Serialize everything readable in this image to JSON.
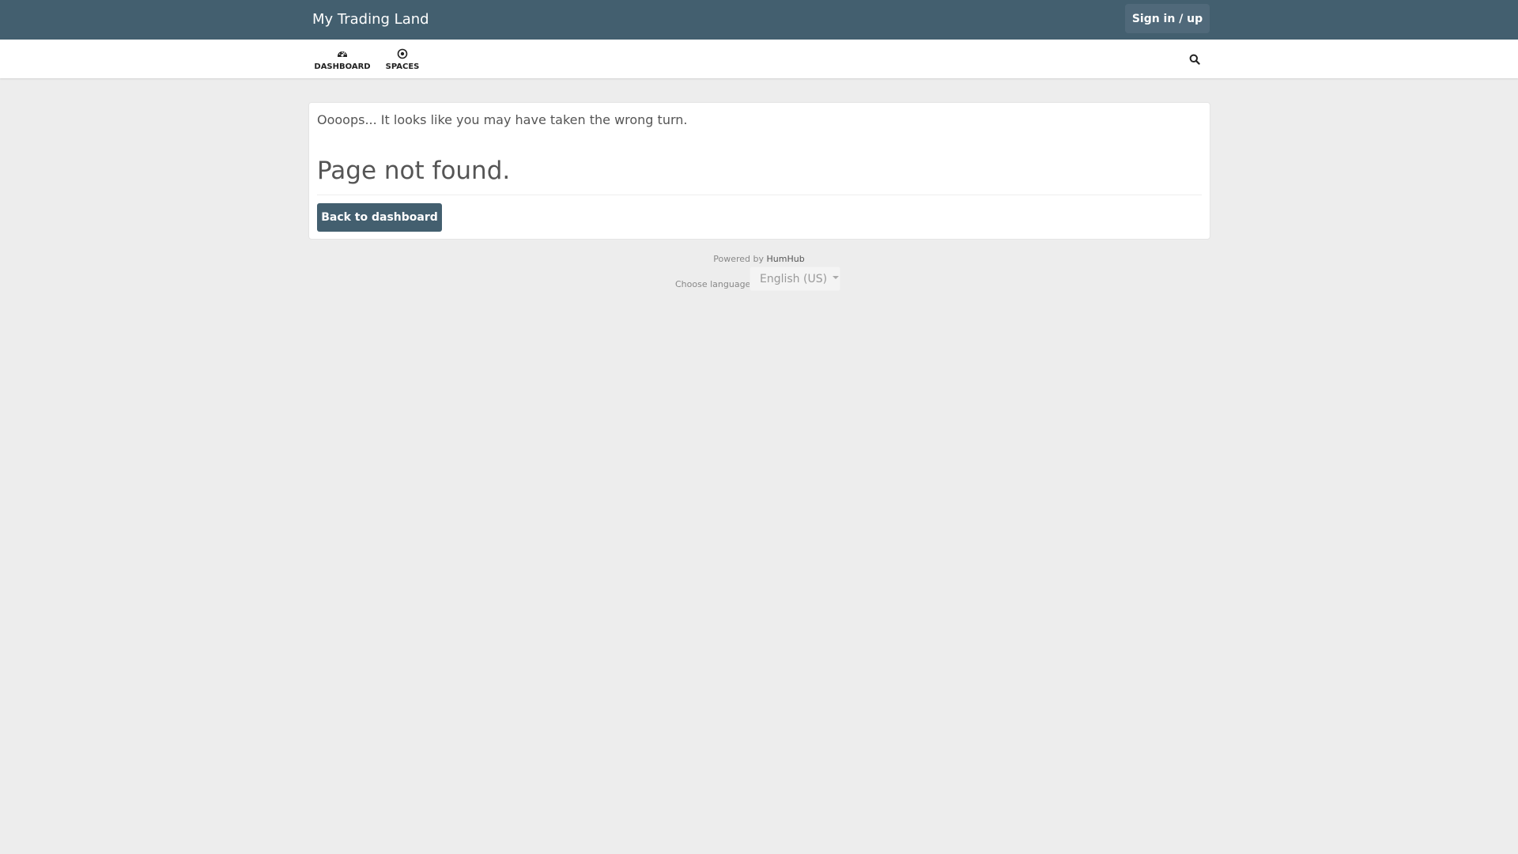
{
  "header": {
    "brand": "My Trading Land",
    "signin_label": "Sign in / up",
    "bg_color": "#435f6f"
  },
  "nav": {
    "items": [
      {
        "label": "DASHBOARD",
        "icon": "dashboard-icon"
      },
      {
        "label": "SPACES",
        "icon": "dot-circle-icon"
      }
    ],
    "search_icon": "search-icon"
  },
  "error_panel": {
    "message": "Oooops... It looks like you may have taken the wrong turn.",
    "title": "Page not found.",
    "back_label": "Back to dashboard"
  },
  "footer": {
    "powered_prefix": "Powered by",
    "powered_link": "HumHub",
    "language_label": "Choose language:",
    "language_value": "English (US)"
  }
}
